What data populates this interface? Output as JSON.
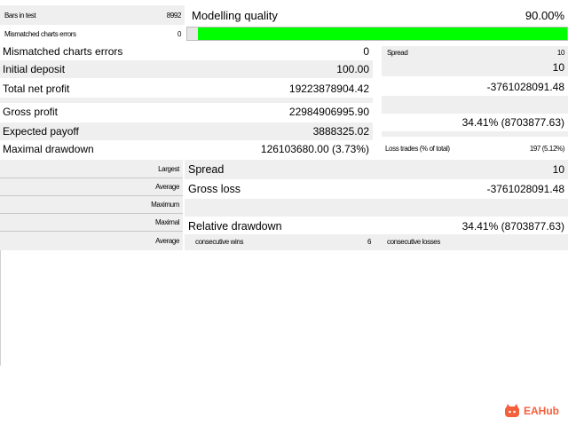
{
  "report": {
    "bars_in_test": {
      "label": "Bars in test",
      "value": "8992"
    },
    "modelling_quality": {
      "label": "Modelling quality",
      "value": "90.00%",
      "fraction": 0.9
    },
    "mismatched_small": {
      "label": "Mismatched charts errors",
      "value": "0"
    },
    "mismatched": {
      "label": "Mismatched charts errors",
      "value": "0"
    },
    "spread_small": {
      "label": "Spread",
      "value": "10"
    },
    "initial_deposit": {
      "label": "Initial deposit",
      "value": "100.00"
    },
    "right_value_1": "10",
    "total_net_profit": {
      "label": "Total net profit",
      "value": "19223878904.42"
    },
    "right_value_2": "-3761028091.48",
    "gross_profit": {
      "label": "Gross profit",
      "value": "22984906995.90"
    },
    "right_value_3": "34.41% (8703877.63)",
    "expected_payoff": {
      "label": "Expected payoff",
      "value": "3888325.02"
    },
    "maximal_drawdown": {
      "label": "Maximal drawdown",
      "value": "126103680.00 (3.73%)"
    },
    "loss_trades_small": {
      "label": "Loss trades (% of total)",
      "value": "197 (5.12%)"
    },
    "largest_label": "Largest",
    "spread": {
      "label": "Spread",
      "value": "10"
    },
    "average_label_1": "Average",
    "gross_loss": {
      "label": "Gross loss",
      "value": "-3761028091.48"
    },
    "maximum_label": "Maximum",
    "maximal_label": "Maximal",
    "relative_drawdown": {
      "label": "Relative drawdown",
      "value": "34.41% (8703877.63)"
    },
    "average_label_2": "Average",
    "consecutive_wins": {
      "label": "consecutive wins",
      "value": "6"
    },
    "consecutive_losses": {
      "label": "consecutive losses",
      "value": ""
    }
  },
  "watermark": {
    "text": "EAHub",
    "icon": "cat-face-icon",
    "color": "#f4603c"
  },
  "colors": {
    "progress": "#00ff00",
    "row_gray": "#efefef"
  }
}
